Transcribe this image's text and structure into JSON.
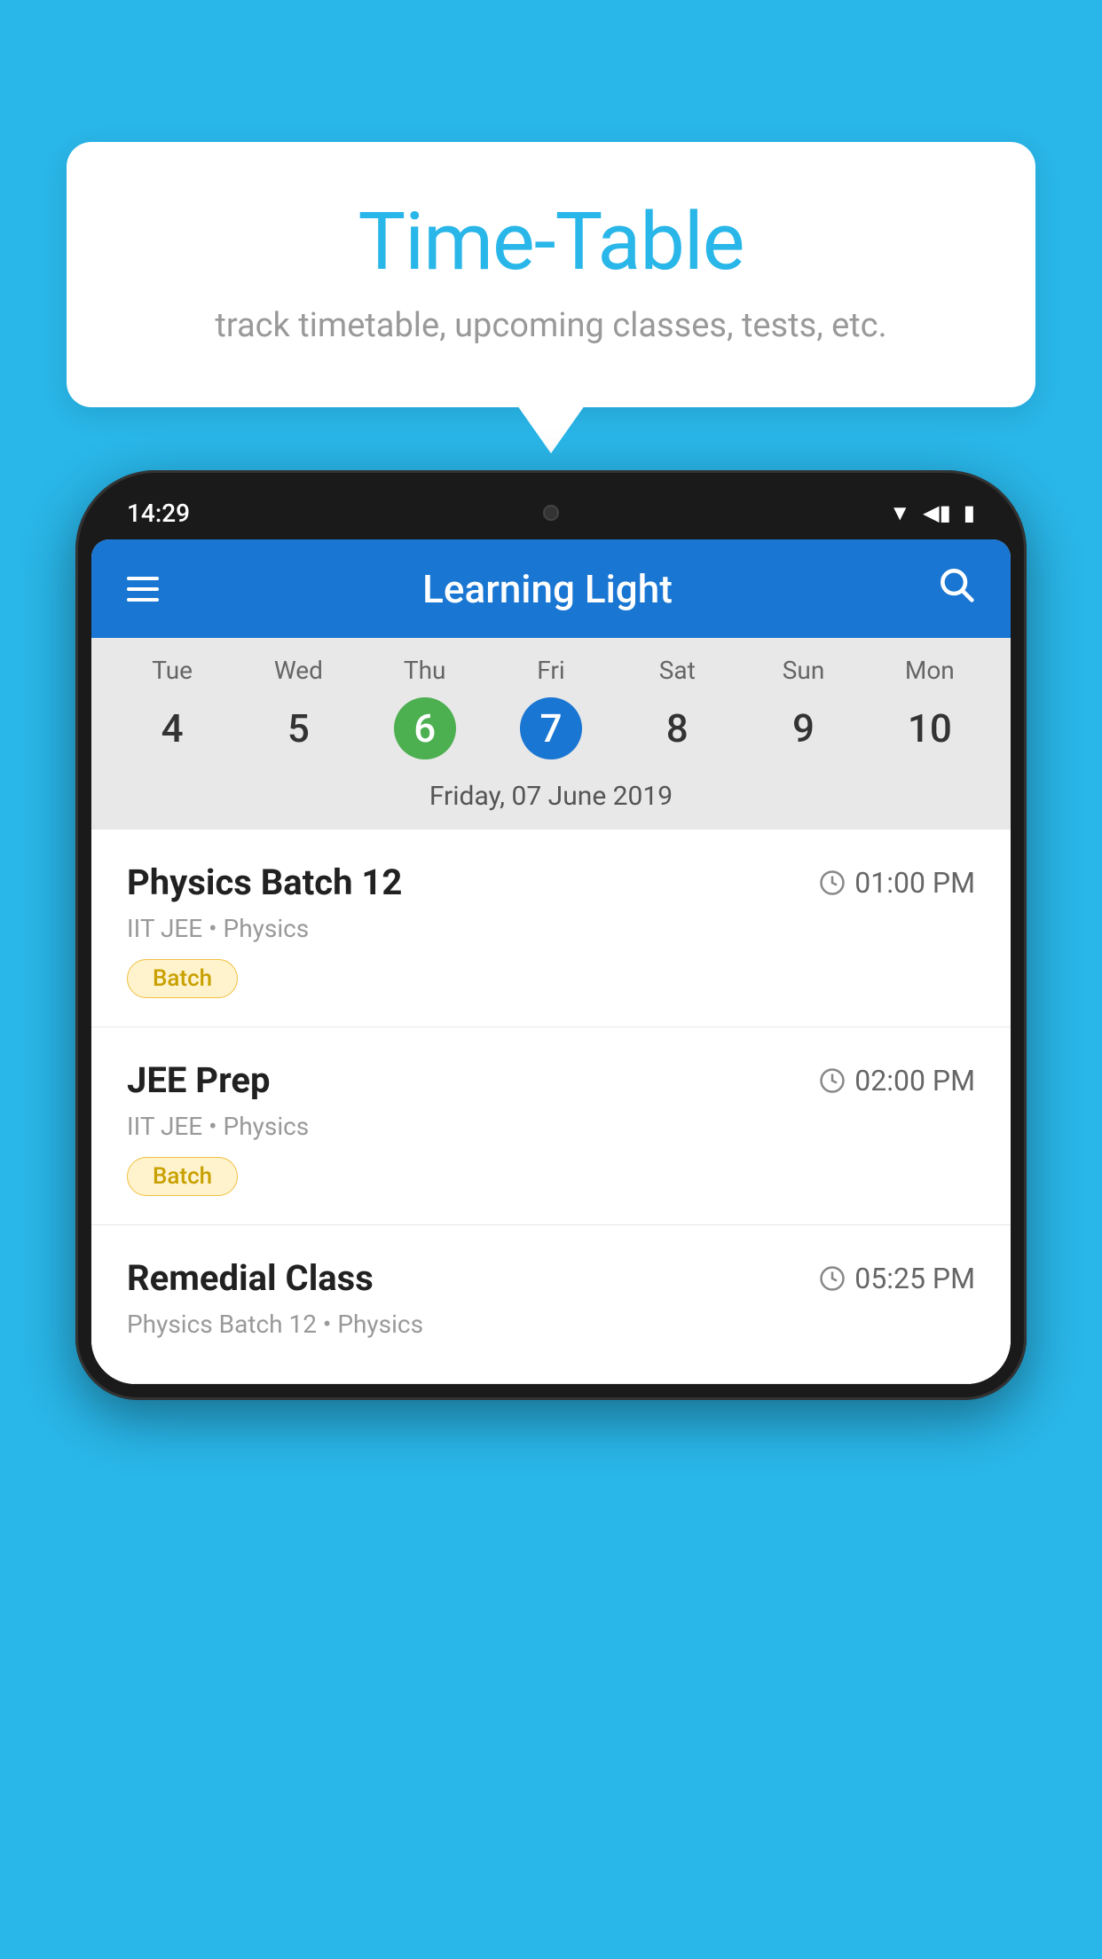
{
  "background_color": "#29b6e8",
  "bubble": {
    "title": "Time-Table",
    "subtitle": "track timetable, upcoming classes, tests, etc."
  },
  "phone": {
    "status_bar": {
      "time": "14:29",
      "icons": [
        "wifi",
        "signal",
        "battery"
      ]
    },
    "header": {
      "title": "Learning Light",
      "menu_icon": "hamburger-icon",
      "search_icon": "search-icon"
    },
    "calendar": {
      "days": [
        {
          "name": "Tue",
          "num": "4",
          "state": "normal"
        },
        {
          "name": "Wed",
          "num": "5",
          "state": "normal"
        },
        {
          "name": "Thu",
          "num": "6",
          "state": "today"
        },
        {
          "name": "Fri",
          "num": "7",
          "state": "selected"
        },
        {
          "name": "Sat",
          "num": "8",
          "state": "normal"
        },
        {
          "name": "Sun",
          "num": "9",
          "state": "normal"
        },
        {
          "name": "Mon",
          "num": "10",
          "state": "normal"
        }
      ],
      "selected_date_label": "Friday, 07 June 2019"
    },
    "schedule": [
      {
        "title": "Physics Batch 12",
        "time": "01:00 PM",
        "meta": "IIT JEE • Physics",
        "badge": "Batch"
      },
      {
        "title": "JEE Prep",
        "time": "02:00 PM",
        "meta": "IIT JEE • Physics",
        "badge": "Batch"
      },
      {
        "title": "Remedial Class",
        "time": "05:25 PM",
        "meta": "Physics Batch 12 • Physics",
        "badge": null
      }
    ]
  }
}
